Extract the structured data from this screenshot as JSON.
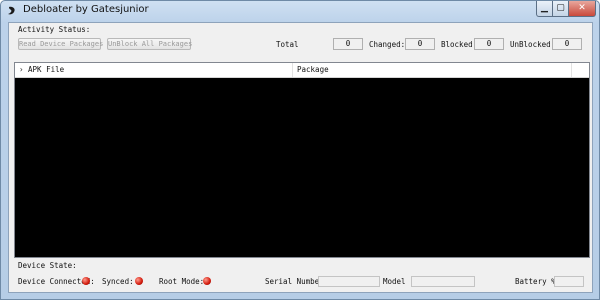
{
  "window": {
    "title": "Debloater by Gatesjunior",
    "controls": {
      "minimize": "▁",
      "maximize": "▢",
      "close": "✕"
    }
  },
  "activity": {
    "label": "Activity Status:",
    "read_button": "Read Device Packages",
    "unblock_button": "UnBlock All Packages",
    "total_label": "Total",
    "total_value": "0",
    "changed_label": "Changed:",
    "changed_value": "0",
    "blocked_label": "Blocked",
    "blocked_value": "0",
    "unblocked_label": "UnBlocked:",
    "unblocked_value": "0"
  },
  "table": {
    "columns": [
      "APK File",
      "Package"
    ],
    "sort_glyph": "›",
    "rows": []
  },
  "device": {
    "state_label": "Device State:",
    "connected_label": "Device Connected:",
    "synced_label": "Synced:",
    "root_label": "Root Mode:",
    "serial_label": "Serial Number:",
    "serial_value": "",
    "model_label": "Model",
    "model_value": "",
    "battery_label": "Battery %:",
    "battery_value": "",
    "status_color": "#d21a0c"
  }
}
